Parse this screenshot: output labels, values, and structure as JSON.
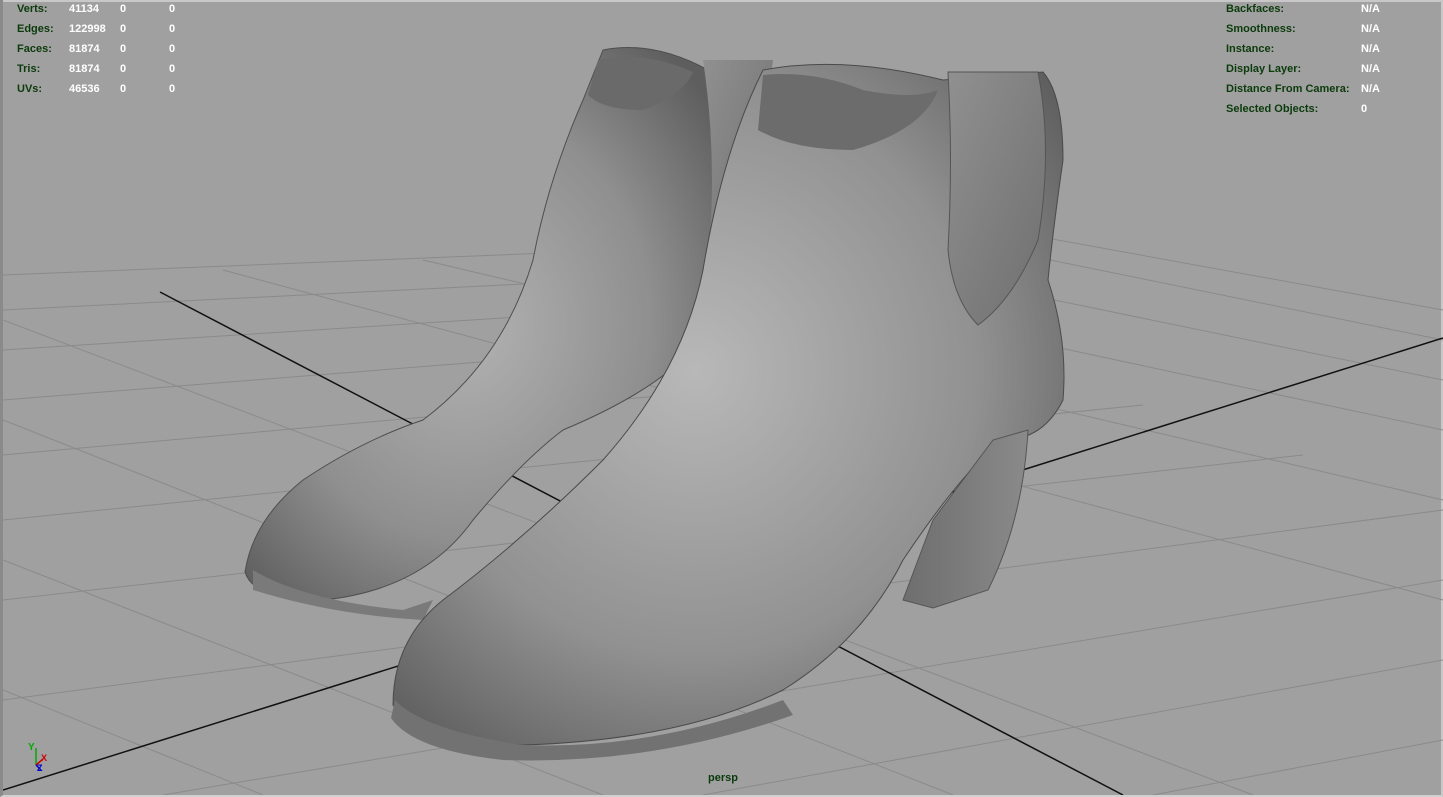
{
  "stats": {
    "rows": [
      {
        "label": "Verts:",
        "v1": "41134",
        "v2": "0",
        "v3": "0"
      },
      {
        "label": "Edges:",
        "v1": "122998",
        "v2": "0",
        "v3": "0"
      },
      {
        "label": "Faces:",
        "v1": "81874",
        "v2": "0",
        "v3": "0"
      },
      {
        "label": "Tris:",
        "v1": "81874",
        "v2": "0",
        "v3": "0"
      },
      {
        "label": "UVs:",
        "v1": "46536",
        "v2": "0",
        "v3": "0"
      }
    ]
  },
  "info": {
    "rows": [
      {
        "label": "Backfaces:",
        "value": "N/A"
      },
      {
        "label": "Smoothness:",
        "value": "N/A"
      },
      {
        "label": "Instance:",
        "value": "N/A"
      },
      {
        "label": "Display Layer:",
        "value": "N/A"
      },
      {
        "label": "Distance From Camera:",
        "value": "N/A"
      },
      {
        "label": "Selected Objects:",
        "value": "0"
      }
    ]
  },
  "camera": "persp",
  "axis": {
    "y": "Y",
    "x": "X",
    "z": "Z"
  },
  "colors": {
    "background": "#a0a0a0",
    "grid": "#8b8b8b",
    "hud_label": "#0b3a0b",
    "hud_value": "#ffffff",
    "model": "#8c8c8c"
  }
}
